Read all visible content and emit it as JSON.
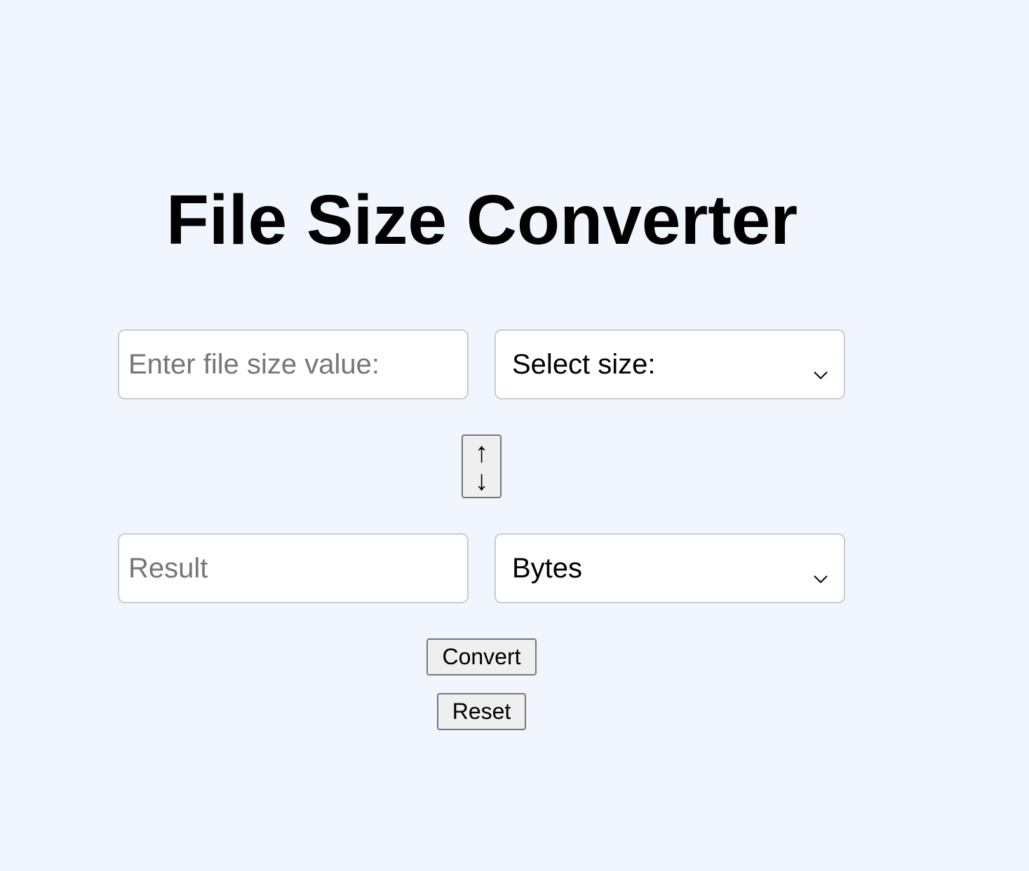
{
  "title": "File Size Converter",
  "input": {
    "value": "",
    "placeholder": "Enter file size value:"
  },
  "from_select": {
    "selected": "Select size:",
    "icon": "chevron-down-icon"
  },
  "swap_button": {
    "up_glyph": "↑",
    "down_glyph": "↓",
    "icon": "swap-vertical-icon"
  },
  "result": {
    "value": "",
    "placeholder": "Result"
  },
  "to_select": {
    "selected": "Bytes",
    "icon": "chevron-down-icon"
  },
  "buttons": {
    "convert_label": "Convert",
    "reset_label": "Reset"
  },
  "colors": {
    "background": "#f1f6fe",
    "field_border": "#c9cdd2",
    "button_bg": "#efefef",
    "placeholder": "#767676"
  }
}
